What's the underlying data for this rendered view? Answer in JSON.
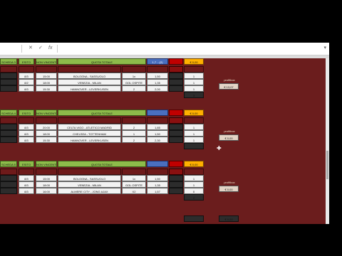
{
  "formula_bar": {
    "cell_ref": "",
    "cancel_icon": "close-icon",
    "confirm_icon": "check-icon",
    "fx_label": "fx"
  },
  "headers": {
    "match_date_col": "",
    "time_col": "",
    "teams_col": "",
    "odds_col": ""
  },
  "blocks": [
    {
      "schedina": "SCHEDA 3",
      "esito": "ESITO",
      "status": "NON VINCENTE",
      "quota_label": "QUOTA TOTALE",
      "quota_value": "1,7 ...(2)",
      "stake": "€ 0,00",
      "profit_label": "profitbox",
      "profit_value": "€ 13,07",
      "result_total": "3",
      "rows": [
        {
          "date": "8/3",
          "time": "15:00",
          "match": "BOLOGNA - SASSUOLO",
          "pick": "1x",
          "odds": "1,50",
          "flag": "1"
        },
        {
          "date": "8/2",
          "time": "18:00",
          "match": "VENEZIA - MILAN",
          "pick": "GOL OSPITE",
          "odds": "1,35",
          "flag": "1"
        },
        {
          "date": "8/3",
          "time": "15:30",
          "match": "HANNOVER - LEVERKUSEN",
          "pick": "2",
          "odds": "2,00",
          "flag": "1"
        }
      ]
    },
    {
      "schedina": "SCHEDA 4",
      "esito": "ESITO",
      "status": "NON VINCENTE",
      "quota_label": "QUOTA TOTALE",
      "quota_value": "",
      "stake": "€ 0,00",
      "profit_label": "profitbox",
      "profit_value": "€ 0,00",
      "result_total": "",
      "rows": [
        {
          "date": "8/3",
          "time": "20:00",
          "match": "CELTA VIGO - ATLETICO MADRID",
          "pick": "2",
          "odds": "1,85",
          "flag": "1"
        },
        {
          "date": "8/3",
          "time": "18:00",
          "match": "CHELSEA - TOTTENHAM",
          "pick": "1",
          "odds": "1,50",
          "flag": "1"
        },
        {
          "date": "8/3",
          "time": "15:30",
          "match": "HANNOVER - LEVERKUSEN",
          "pick": "2",
          "odds": "2,30",
          "flag": "1"
        }
      ]
    },
    {
      "schedina": "SCHEDA 5",
      "esito": "ESITO",
      "status": "NON VINCENTE",
      "quota_label": "QUOTA TOTALE",
      "quota_value": "",
      "stake": "€ 0,00",
      "profit_label": "profitbox",
      "profit_value": "€ 0,00",
      "result_total": "2",
      "rows": [
        {
          "date": "8/3",
          "time": "15:00",
          "match": "BOLOGNA - SASSUOLO",
          "pick": "1x",
          "odds": "1,50",
          "flag": "1"
        },
        {
          "date": "8/3",
          "time": "18:00",
          "match": "VENEZIA - MILAN",
          "pick": "GOL OSPITE",
          "odds": "1,35",
          "flag": "1"
        },
        {
          "date": "8/3",
          "time": "16:00",
          "match": "ALMERE CITY - JONG AJAX",
          "pick": "X2",
          "odds": "1,57",
          "flag": "0"
        }
      ]
    }
  ],
  "footer": {
    "total": "€ 0,00"
  }
}
